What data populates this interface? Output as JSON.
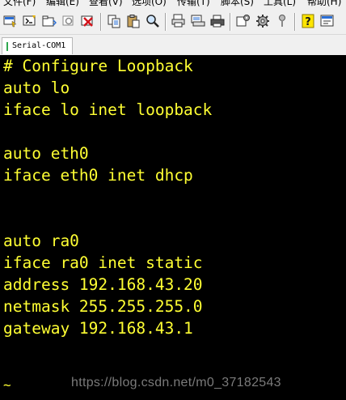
{
  "menubar": {
    "items": [
      "文件(F)",
      "编辑(E)",
      "查看(V)",
      "选项(O)",
      "传输(T)",
      "脚本(S)",
      "工具(L)",
      "帮助(H)"
    ]
  },
  "toolbar": {
    "buttons": [
      {
        "name": "connect-icon"
      },
      {
        "name": "quick-connect-icon"
      },
      {
        "name": "connect-in-tab-icon"
      },
      {
        "name": "reconnect-icon"
      },
      {
        "name": "disconnect-icon"
      },
      {
        "name": "copy-icon"
      },
      {
        "name": "paste-icon"
      },
      {
        "name": "find-icon"
      },
      {
        "name": "print-icon"
      },
      {
        "name": "print-setup-icon"
      },
      {
        "name": "printer-icon"
      },
      {
        "name": "session-options-icon"
      },
      {
        "name": "global-options-icon"
      },
      {
        "name": "keymap-icon"
      },
      {
        "name": "help-icon"
      },
      {
        "name": "about-icon"
      }
    ]
  },
  "tabs": [
    {
      "label": "Serial-COM1"
    }
  ],
  "terminal": {
    "lines": [
      "# Configure Loopback",
      "auto lo",
      "iface lo inet loopback",
      "",
      "auto eth0",
      "iface eth0 inet dhcp",
      "",
      "",
      "auto ra0",
      "iface ra0 inet static",
      "address 192.168.43.20",
      "netmask 255.255.255.0",
      "gateway 192.168.43.1"
    ],
    "tilde": "~",
    "text_color": "#ffff33",
    "background": "#000000"
  },
  "watermark": "https://blog.csdn.net/m0_37182543"
}
